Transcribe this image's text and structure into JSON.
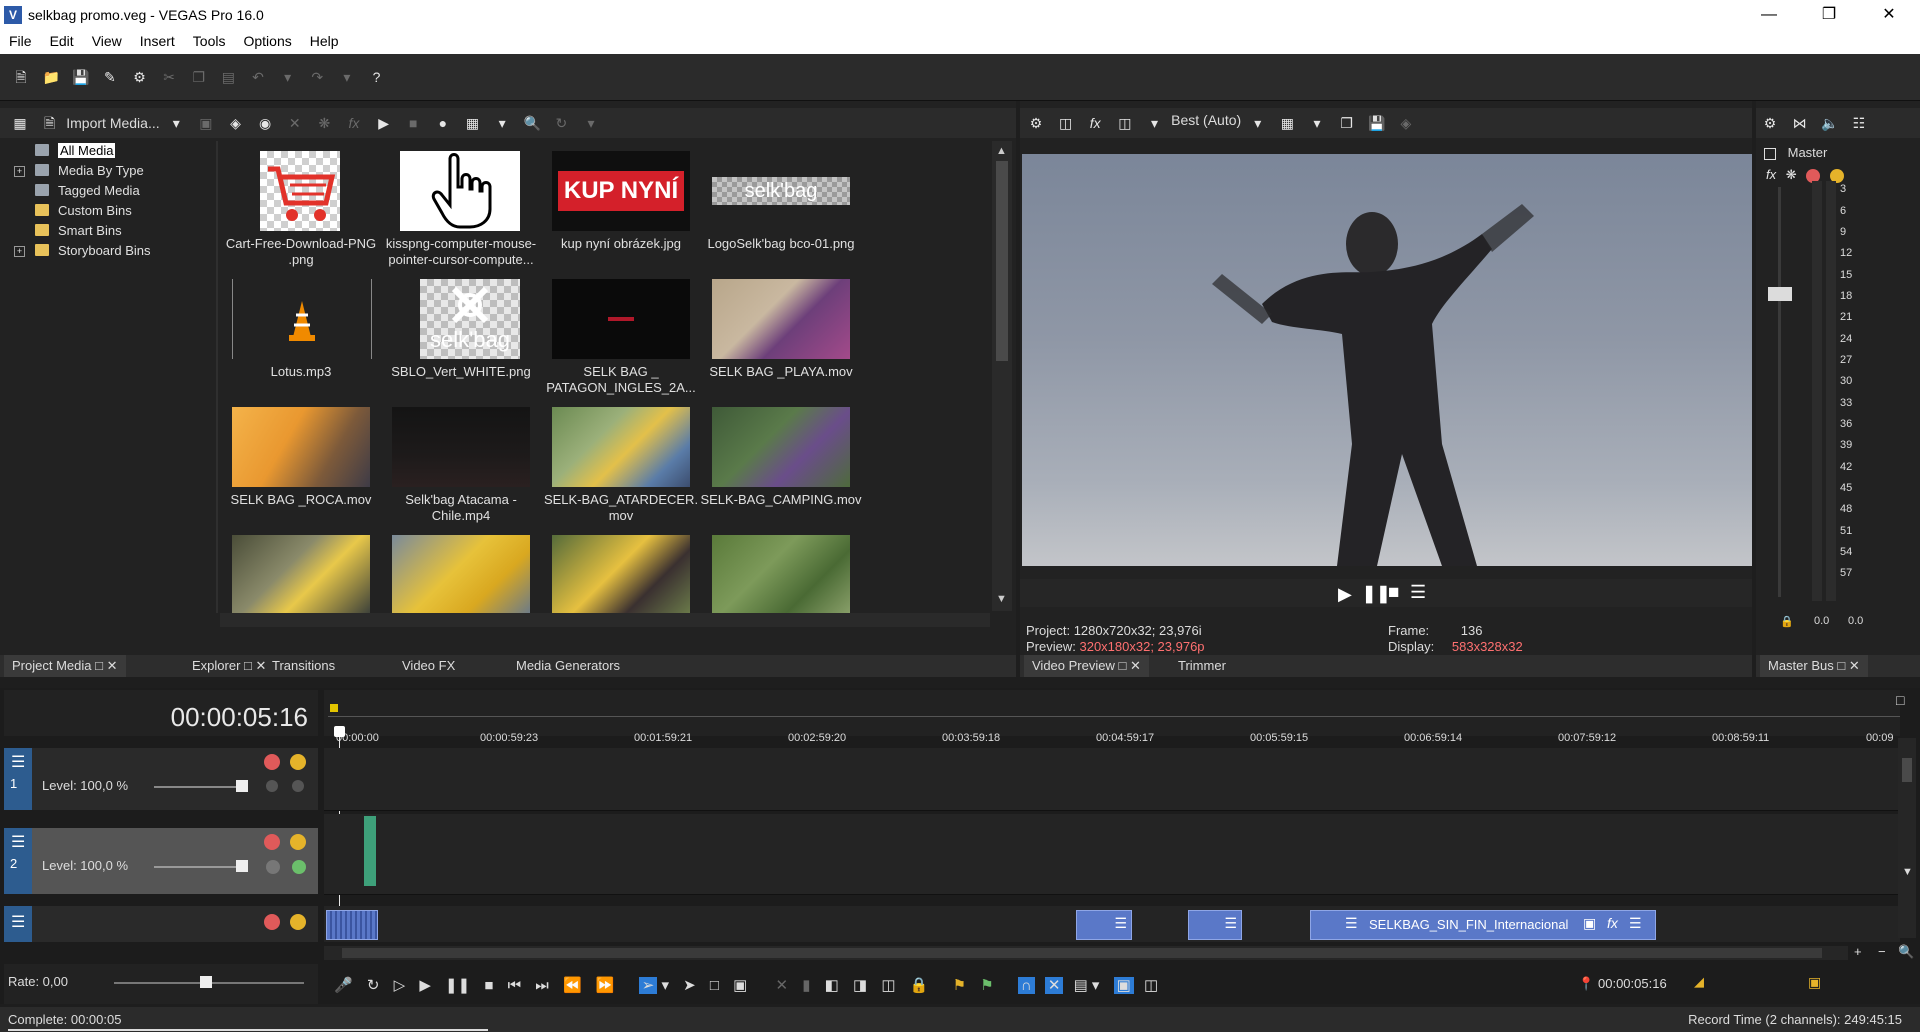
{
  "window": {
    "title": "selkbag promo.veg - VEGAS Pro 16.0",
    "app_icon": "V"
  },
  "menu": [
    "File",
    "Edit",
    "View",
    "Insert",
    "Tools",
    "Options",
    "Help"
  ],
  "media_panel": {
    "import_label": "Import Media...",
    "tree": [
      {
        "label": "All Media",
        "selected": true,
        "expandable": false
      },
      {
        "label": "Media By Type",
        "selected": false,
        "expandable": true
      },
      {
        "label": "Tagged Media",
        "selected": false,
        "expandable": false
      },
      {
        "label": "Custom Bins",
        "selected": false,
        "expandable": false
      },
      {
        "label": "Smart Bins",
        "selected": false,
        "expandable": false
      },
      {
        "label": "Storyboard Bins",
        "selected": false,
        "expandable": true
      }
    ],
    "items": [
      {
        "caption": "Cart-Free-Download-PNG .png",
        "line1": "Cart-Free-Download-PNG",
        "line2": ".png"
      },
      {
        "caption": "kisspng-computer-mouse-pointer-cursor-compute...",
        "line1": "kisspng-computer-mouse-",
        "line2": "pointer-cursor-compute..."
      },
      {
        "caption": "kup nyní obrázek.jpg",
        "line1": "kup nyní obrázek.jpg",
        "line2": "",
        "thumb_text": "KUP NYNÍ"
      },
      {
        "caption": "LogoSelk'bag bco-01.png",
        "line1": "LogoSelk'bag bco-01.png",
        "line2": "",
        "thumb_text": "selk'bag"
      },
      {
        "caption": "Lotus.mp3",
        "line1": "Lotus.mp3",
        "line2": ""
      },
      {
        "caption": "SBLO_Vert_WHITE.png",
        "line1": "SBLO_Vert_WHITE.png",
        "line2": "",
        "thumb_text": "selk'bag"
      },
      {
        "caption": "SELK BAG _ PATAGON_INGLES_2A...",
        "line1": "SELK BAG _",
        "line2": "PATAGON_INGLES_2A..."
      },
      {
        "caption": "SELK BAG _PLAYA.mov",
        "line1": "SELK BAG _PLAYA.mov",
        "line2": ""
      },
      {
        "caption": "SELK BAG _ROCA.mov",
        "line1": "SELK BAG _ROCA.mov",
        "line2": ""
      },
      {
        "caption": "Selk'bag Atacama - Chile.mp4",
        "line1": "Selk'bag Atacama -",
        "line2": "Chile.mp4"
      },
      {
        "caption": "SELK-BAG_ATARDECER.mov",
        "line1": "SELK-BAG_ATARDECER.",
        "line2": "mov"
      },
      {
        "caption": "SELK-BAG_CAMPING.mov",
        "line1": "SELK-BAG_CAMPING.mov",
        "line2": ""
      },
      {
        "caption": "",
        "line1": "",
        "line2": ""
      },
      {
        "caption": "",
        "line1": "",
        "line2": ""
      },
      {
        "caption": "",
        "line1": "",
        "line2": ""
      },
      {
        "caption": "",
        "line1": "",
        "line2": ""
      }
    ],
    "tabs": [
      "Project Media",
      "Explorer",
      "Transitions",
      "Video FX",
      "Media Generators"
    ]
  },
  "preview": {
    "quality": "Best (Auto)",
    "project_label": "Project:",
    "project_value": "1280x720x32; 23,976i",
    "preview_label": "Preview:",
    "preview_value": "320x180x32; 23,976p",
    "frame_label": "Frame:",
    "frame_value": "136",
    "display_label": "Display:",
    "display_value": "583x328x32",
    "tabs": [
      "Video Preview",
      "Trimmer"
    ]
  },
  "master": {
    "label": "Master",
    "scale": [
      "3",
      "6",
      "9",
      "12",
      "15",
      "18",
      "21",
      "24",
      "27",
      "30",
      "33",
      "36",
      "39",
      "42",
      "45",
      "48",
      "51",
      "54",
      "57"
    ],
    "left_value": "0.0",
    "right_value": "0.0",
    "tab": "Master Bus"
  },
  "timeline": {
    "timecode": "00:00:05:16",
    "ruler": [
      "00:00:00",
      "00:00:59:23",
      "00:01:59:21",
      "00:02:59:20",
      "00:03:59:18",
      "00:04:59:17",
      "00:05:59:15",
      "00:06:59:14",
      "00:07:59:12",
      "00:08:59:11",
      "00:09"
    ],
    "tracks": [
      {
        "number": "1",
        "level": "Level: 100,0 %"
      },
      {
        "number": "2",
        "level": "Level: 100,0 %"
      },
      {
        "number": "",
        "level": ""
      }
    ],
    "clip_label": "SELKBAG_SIN_FIN_Internacional",
    "rate": "Rate: 0,00",
    "cursor_time": "00:00:05:16"
  },
  "status": {
    "left": "Complete: 00:00:05",
    "right": "Record Time (2 channels): 249:45:15"
  },
  "colors": {
    "accent_blue": "#2d7cd6",
    "clip_blue": "#5a78c8",
    "track_green": "#3ea07a",
    "warn_red": "#ff7070"
  }
}
